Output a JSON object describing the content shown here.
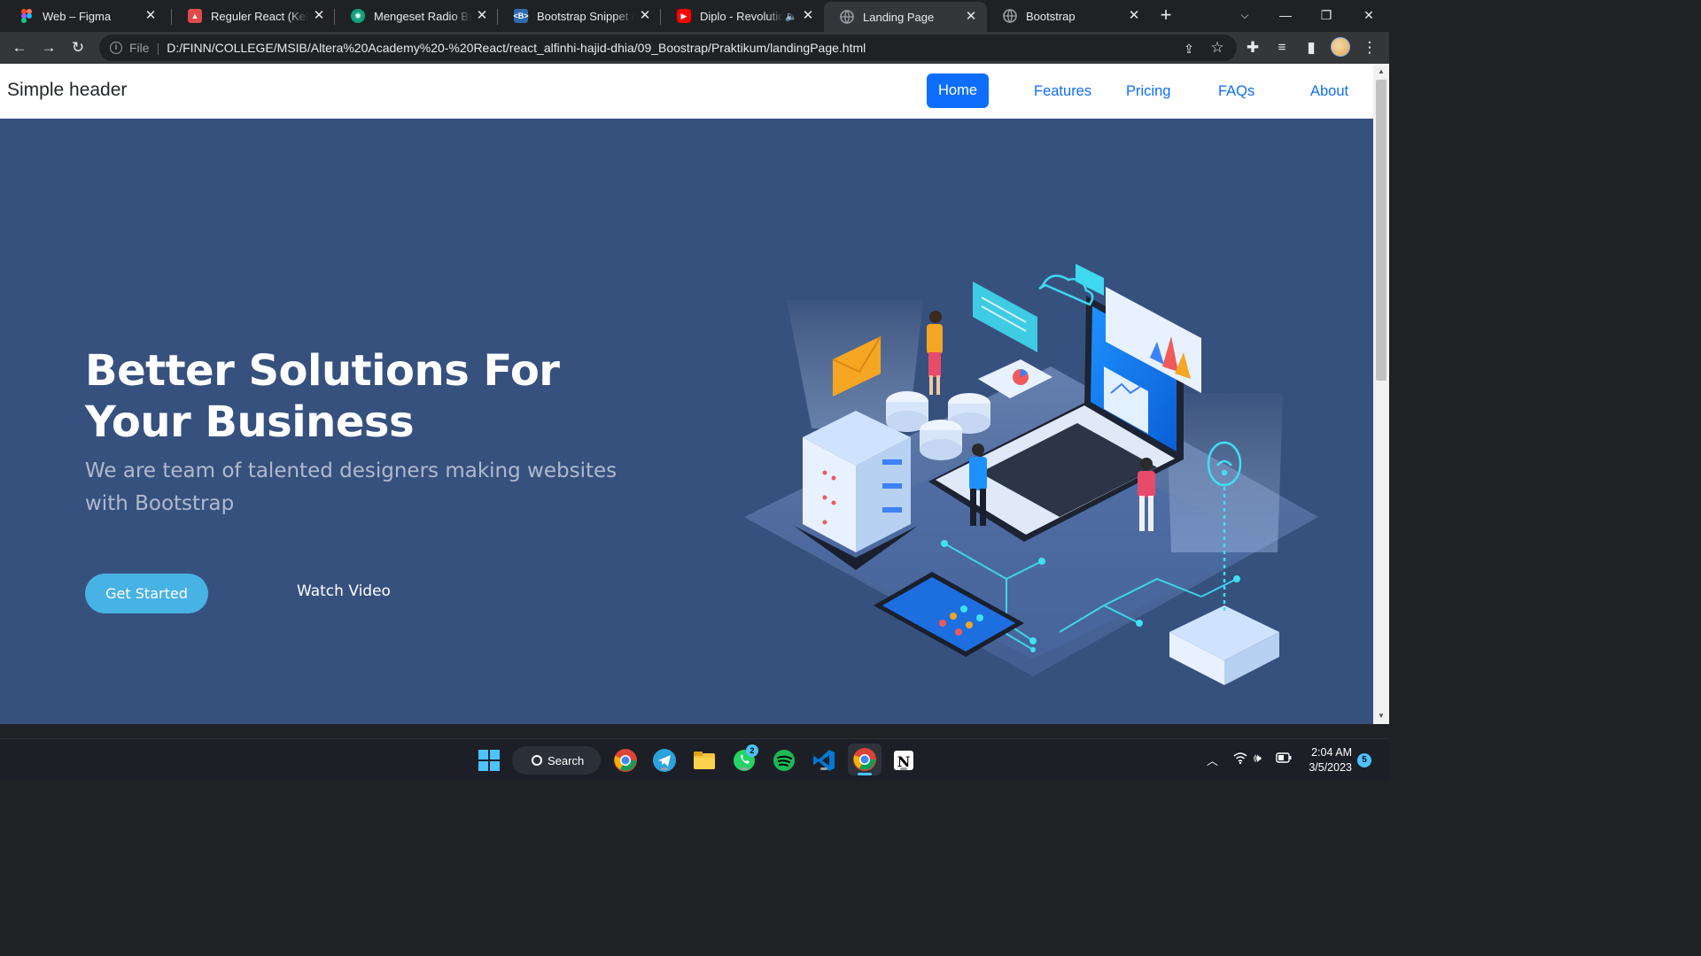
{
  "browser": {
    "tabs": [
      {
        "title": "Web – Figma",
        "icon": "figma-icon",
        "color": "#f24e1e",
        "active": false
      },
      {
        "title": "Reguler React (Kelas A",
        "icon": "alterra-icon",
        "color": "#e04a4a",
        "active": false
      },
      {
        "title": "Mengeset Radio Butto",
        "icon": "chatgpt-icon",
        "color": "#10a37f",
        "active": false
      },
      {
        "title": "Bootstrap Snippet con",
        "icon": "bootstrap-snippet-icon",
        "color": "#2b6cb0",
        "active": false
      },
      {
        "title": "Diplo - Revolution",
        "icon": "youtube-icon",
        "color": "#ff0000",
        "active": false,
        "audio": true
      },
      {
        "title": "Landing Page",
        "icon": "globe-icon",
        "color": "#9aa0a6",
        "active": true
      },
      {
        "title": "Bootstrap",
        "icon": "globe-icon",
        "color": "#9aa0a6",
        "active": false
      }
    ],
    "new_tab": "+",
    "address": {
      "scheme_label": "File",
      "url": "D:/FINN/COLLEGE/MSIB/Altera%20Academy%20-%20React/react_alfinhi-hajid-dhia/09_Boostrap/Praktikum/landingPage.html"
    }
  },
  "page": {
    "navbar": {
      "brand": "Simple header",
      "links": [
        "Home",
        "Features",
        "Pricing",
        "FAQs",
        "About"
      ],
      "active": "Home"
    },
    "hero": {
      "title": "Better Solutions For Your Business",
      "subtitle": "We are team of talented designers making websites with Bootstrap",
      "primary_button": "Get Started",
      "secondary_button": "Watch Video",
      "background_color": "#37517e",
      "accent_color": "#47b2e4"
    }
  },
  "taskbar": {
    "search_label": "Search",
    "apps": [
      "windows-start-icon",
      "chrome-icon",
      "telegram-icon",
      "file-explorer-icon",
      "whatsapp-icon",
      "spotify-icon",
      "vscode-icon",
      "chrome-icon",
      "notion-icon"
    ],
    "whatsapp_badge": "2",
    "time": "2:04 AM",
    "date": "3/5/2023",
    "notification_count": "5"
  }
}
